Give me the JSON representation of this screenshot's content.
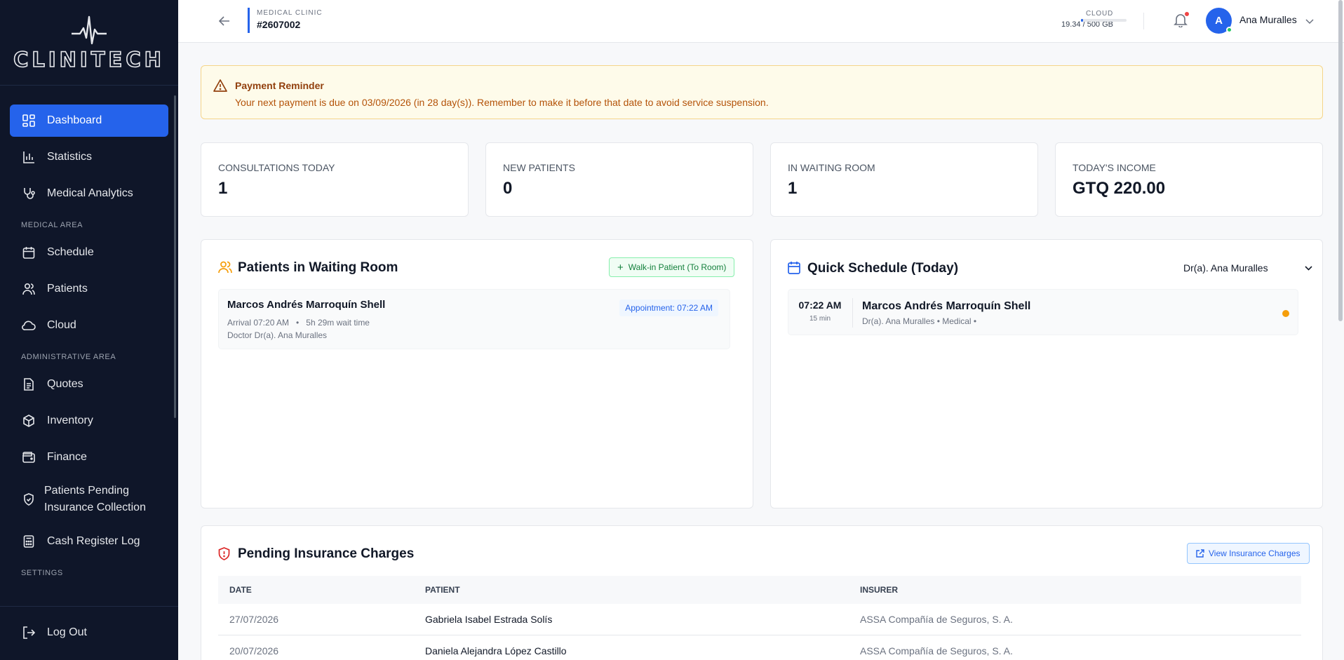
{
  "app": {
    "logo_text": "CLINITECH"
  },
  "sidebar": {
    "items": [
      {
        "label": "Dashboard",
        "icon": "dashboard-icon",
        "active": true
      },
      {
        "label": "Statistics",
        "icon": "bar-chart-icon"
      },
      {
        "label": "Medical Analytics",
        "icon": "stethoscope-icon"
      }
    ],
    "medical_section": "MEDICAL AREA",
    "medical_items": [
      {
        "label": "Schedule",
        "icon": "calendar-icon"
      },
      {
        "label": "Patients",
        "icon": "users-icon"
      },
      {
        "label": "Cloud",
        "icon": "cloud-icon"
      }
    ],
    "admin_section": "ADMINISTRATIVE AREA",
    "admin_items": [
      {
        "label": "Quotes",
        "icon": "document-icon"
      },
      {
        "label": "Inventory",
        "icon": "box-icon"
      },
      {
        "label": "Finance",
        "icon": "wallet-icon"
      },
      {
        "label": "Patients Pending Insurance Collection",
        "icon": "shield-icon"
      },
      {
        "label": "Cash Register Log",
        "icon": "calculator-icon"
      }
    ],
    "settings_section": "SETTINGS",
    "logout_label": "Log Out"
  },
  "topbar": {
    "clinic_label": "MEDICAL CLINIC",
    "clinic_id": "#2607002",
    "cloud_label": "CLOUD",
    "cloud_usage": "19.34 / 500 GB",
    "cloud_fraction": 0.039,
    "user_initial": "A",
    "user_name": "Ana Muralles"
  },
  "alert": {
    "title": "Payment Reminder",
    "message": "Your next payment is due on 03/09/2026 (in 28 day(s)). Remember to make it before that date to avoid service suspension."
  },
  "stats": [
    {
      "label": "CONSULTATIONS TODAY",
      "value": "1"
    },
    {
      "label": "NEW PATIENTS",
      "value": "0"
    },
    {
      "label": "IN WAITING ROOM",
      "value": "1"
    },
    {
      "label": "TODAY'S INCOME",
      "value": "GTQ 220.00"
    }
  ],
  "waiting_room": {
    "title": "Patients in Waiting Room",
    "walkin_label": "Walk-in Patient (To Room)",
    "patients": [
      {
        "name": "Marcos Andrés Marroquín Shell",
        "arrival": "Arrival 07:20 AM",
        "wait": "5h 29m wait time",
        "doctor": "Doctor Dr(a). Ana Muralles",
        "appointment": "Appointment: 07:22 AM"
      }
    ]
  },
  "quick_schedule": {
    "title": "Quick Schedule (Today)",
    "doctor_selected": "Dr(a). Ana Muralles",
    "items": [
      {
        "time": "07:22 AM",
        "duration": "15 min",
        "name": "Marcos Andrés Marroquín Shell",
        "detail": "Dr(a). Ana Muralles • Medical •",
        "status_color": "#f59e0b"
      }
    ]
  },
  "insurance": {
    "title": "Pending Insurance Charges",
    "view_label": "View Insurance Charges",
    "columns": [
      "DATE",
      "PATIENT",
      "INSURER"
    ],
    "rows": [
      [
        "27/07/2026",
        "Gabriela Isabel Estrada Solís",
        "ASSA Compañía de Seguros, S. A."
      ],
      [
        "20/07/2026",
        "Daniela Alejandra López Castillo",
        "ASSA Compañía de Seguros, S. A."
      ]
    ]
  },
  "colors": {
    "sidebar_bg": "#0f1629",
    "accent": "#2563eb",
    "alert_bg": "#fefbea",
    "walkin_green": "#15803d"
  }
}
